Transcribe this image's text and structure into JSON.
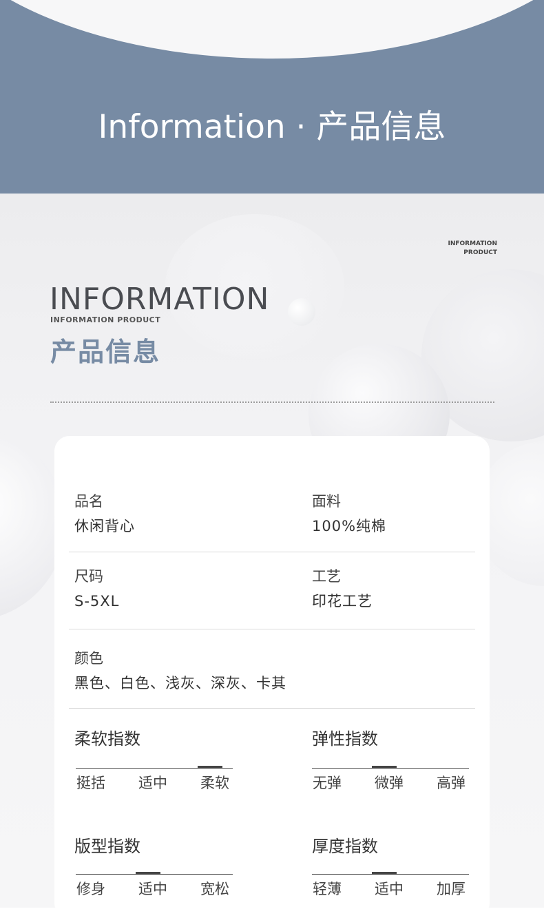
{
  "banner": {
    "title": "Information · 产品信息"
  },
  "header": {
    "small_en_line1": "INFORMATION",
    "small_en_line2": "PRODUCT",
    "big_en": "INFORMATION",
    "sub_en": "INFORMATION PRODUCT",
    "cn_title": "产品信息"
  },
  "info": {
    "name_label": "品名",
    "name_value": "休闲背心",
    "fabric_label": "面料",
    "fabric_value": "100%纯棉",
    "size_label": "尺码",
    "size_value": "S-5XL",
    "craft_label": "工艺",
    "craft_value": "印花工艺",
    "color_label": "颜色",
    "color_value": "黑色、白色、浅灰、深灰、卡其"
  },
  "indices": {
    "softness": {
      "title": "柔软指数",
      "options": [
        "挺括",
        "适中",
        "柔软"
      ],
      "selected": 2
    },
    "elasticity": {
      "title": "弹性指数",
      "options": [
        "无弹",
        "微弹",
        "高弹"
      ],
      "selected": 1
    },
    "fit": {
      "title": "版型指数",
      "options": [
        "修身",
        "适中",
        "宽松"
      ],
      "selected": 1
    },
    "thickness": {
      "title": "厚度指数",
      "options": [
        "轻薄",
        "适中",
        "加厚"
      ],
      "selected": 1
    }
  }
}
